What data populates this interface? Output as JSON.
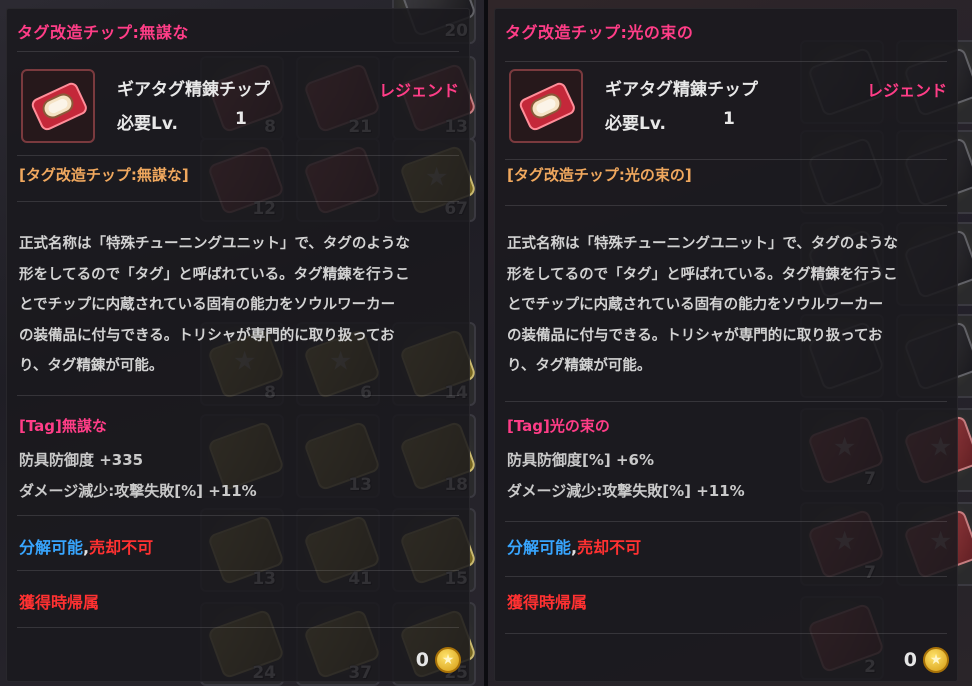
{
  "panels": [
    {
      "title": "タグ改造チップ:無謀な",
      "item_name": "ギアタグ精錬チップ",
      "rarity": "レジェンド",
      "level_label": "必要Lv.",
      "level_value": "1",
      "subtitle": "[タグ改造チップ:無謀な]",
      "description_lines": [
        "正式名称は「特殊チューニングユニット」で、タグのような",
        "形をしてるので「タグ」と呼ばれている。タグ精錬を行うこ",
        "とでチップに内蔵されている固有の能力をソウルワーカー",
        "の装備品に付与できる。トリシャが専門的に取り扱ってお",
        "り、タグ精錬が可能。"
      ],
      "tag_title": "[Tag]無謀な",
      "stat1": "防具防御度 +335",
      "stat2": "ダメージ減少:攻撃失敗[%] +11%",
      "disassemble": "分解可能",
      "comma": ",",
      "no_sell": "売却不可",
      "bound": "獲得時帰属",
      "coin_value": "0",
      "background_counts": [
        "20",
        "8",
        "21",
        "13",
        "12",
        "67",
        "8",
        "6",
        "14",
        "13",
        "18",
        "13",
        "41",
        "15",
        "24",
        "37",
        "25"
      ]
    },
    {
      "title": "タグ改造チップ:光の束の",
      "item_name": "ギアタグ精錬チップ",
      "rarity": "レジェンド",
      "level_label": "必要Lv.",
      "level_value": "1",
      "subtitle": "[タグ改造チップ:光の束の]",
      "description_lines": [
        "正式名称は「特殊チューニングユニット」で、タグのような",
        "形をしてるので「タグ」と呼ばれている。タグ精錬を行うこ",
        "とでチップに内蔵されている固有の能力をソウルワーカー",
        "の装備品に付与できる。トリシャが専門的に取り扱ってお",
        "り、タグ精錬が可能。"
      ],
      "tag_title": "[Tag]光の束の",
      "stat1": "防具防御度[%] +6%",
      "stat2": "ダメージ減少:攻撃失敗[%] +11%",
      "disassemble": "分解可能",
      "comma": ",",
      "no_sell": "売却不可",
      "bound": "獲得時帰属",
      "coin_value": "0",
      "background_counts": [
        "7",
        "7",
        "2"
      ]
    }
  ],
  "colors": {
    "title_pink": "#ff3d87",
    "subtitle_orange": "#f0a85e",
    "disassemble_blue": "#38a6ff",
    "no_sell_red": "#ff3131"
  },
  "icons": {
    "item": "gear-tag-chip-icon",
    "currency": "gold-coin-icon"
  }
}
